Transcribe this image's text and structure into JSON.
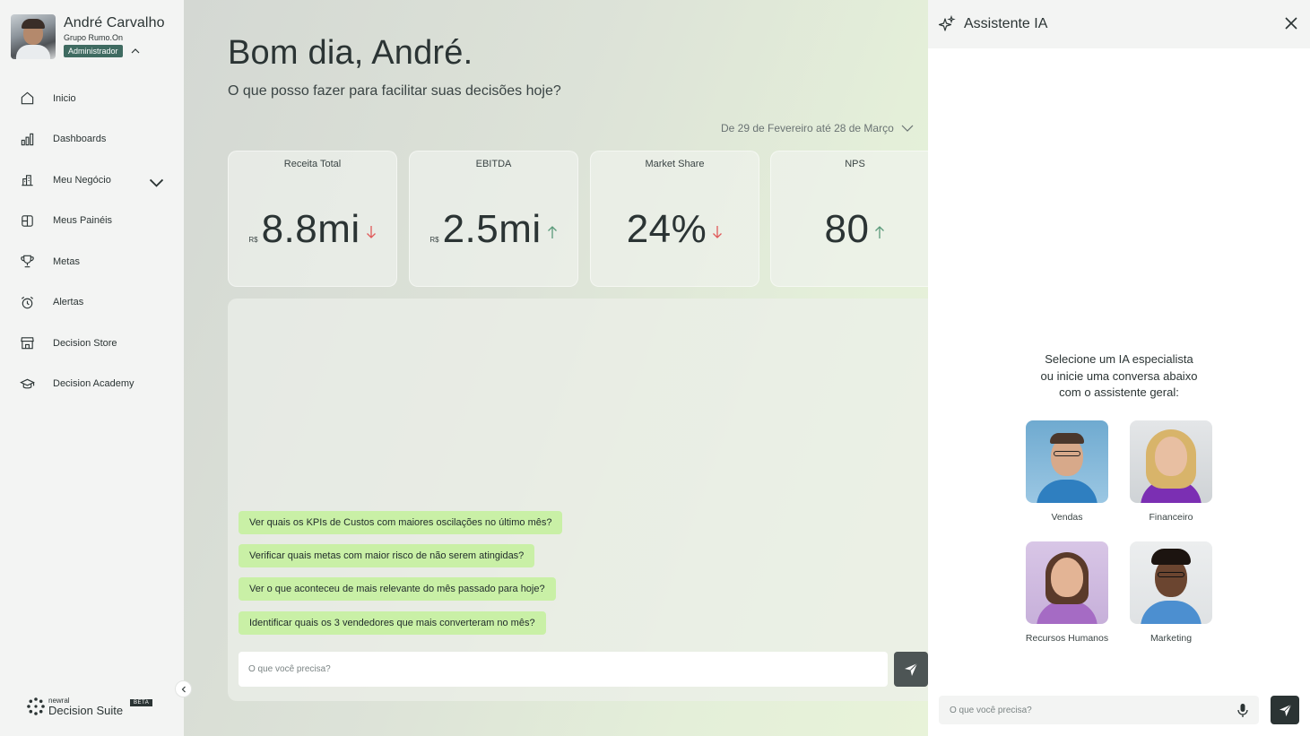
{
  "user": {
    "name": "André Carvalho",
    "company": "Grupo Rumo.On",
    "role": "Administrador"
  },
  "nav": {
    "items": [
      {
        "label": "Inicio",
        "icon": "home-icon"
      },
      {
        "label": "Dashboards",
        "icon": "bar-chart-icon"
      },
      {
        "label": "Meu Negócio",
        "icon": "building-chart-icon"
      },
      {
        "label": "Meus Painéis",
        "icon": "panels-icon"
      },
      {
        "label": "Metas",
        "icon": "trophy-icon"
      },
      {
        "label": "Alertas",
        "icon": "alarm-clock-icon"
      },
      {
        "label": "Decision Store",
        "icon": "store-icon"
      },
      {
        "label": "Decision Academy",
        "icon": "graduation-cap-icon"
      }
    ]
  },
  "brand": {
    "small": "newral",
    "big": "Decision Suite",
    "badge": "BETA"
  },
  "main": {
    "greeting": "Bom dia, André.",
    "subtitle": "O que posso fazer para facilitar suas decisões hoje?",
    "date_range": "De 29 de Fevereiro até 28 de Março",
    "kpis": [
      {
        "title": "Receita Total",
        "currency": "R$",
        "value": "8.8mi",
        "trend": "down",
        "trend_color": "#e05a5a"
      },
      {
        "title": "EBITDA",
        "currency": "R$",
        "value": "2.5mi",
        "trend": "up",
        "trend_color": "#5a9a7a"
      },
      {
        "title": "Market Share",
        "currency": "",
        "value": "24%",
        "trend": "down",
        "trend_color": "#e05a5a"
      },
      {
        "title": "NPS",
        "currency": "",
        "value": "80",
        "trend": "up",
        "trend_color": "#5a9a7a"
      }
    ],
    "suggestions": [
      "Ver quais os KPIs de Custos com maiores oscilações no último mês?",
      "Verificar quais metas com maior risco de não serem atingidas?",
      "Ver o que aconteceu de mais relevante do mês passado para hoje?",
      "Identificar quais os 3 vendedores que mais converteram no mês?"
    ],
    "input_placeholder": "O que você precisa?"
  },
  "assistant": {
    "title": "Assistente IA",
    "intro_lines": [
      "Selecione um IA especialista",
      "ou inicie uma conversa abaixo",
      "com o assistente geral:"
    ],
    "personas": [
      {
        "label": "Vendas"
      },
      {
        "label": "Financeiro"
      },
      {
        "label": "Recursos Humanos"
      },
      {
        "label": "Marketing"
      }
    ],
    "input_placeholder": "O que você precisa?"
  },
  "colors": {
    "accent_green": "#c9f0a6",
    "role_badge": "#3f6b61",
    "trend_down": "#e05a5a",
    "trend_up": "#5a9a7a"
  }
}
